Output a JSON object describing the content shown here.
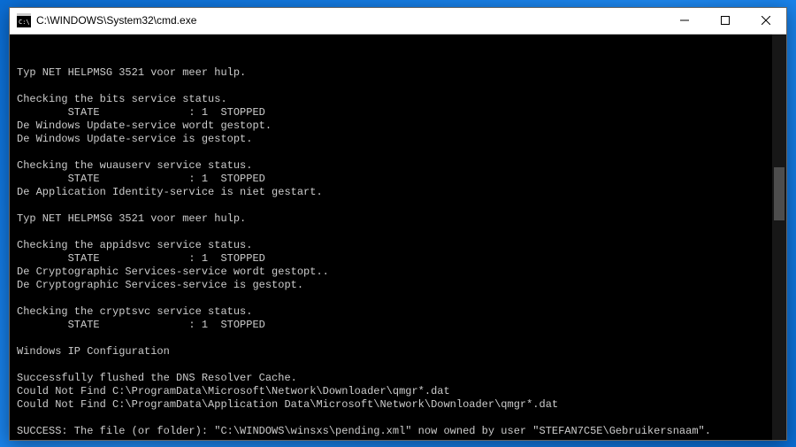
{
  "window": {
    "title": "C:\\WINDOWS\\System32\\cmd.exe"
  },
  "console": {
    "lines": [
      "Typ NET HELPMSG 3521 voor meer hulp.",
      "",
      "Checking the bits service status.",
      "        STATE              : 1  STOPPED",
      "De Windows Update-service wordt gestopt.",
      "De Windows Update-service is gestopt.",
      "",
      "Checking the wuauserv service status.",
      "        STATE              : 1  STOPPED",
      "De Application Identity-service is niet gestart.",
      "",
      "Typ NET HELPMSG 3521 voor meer hulp.",
      "",
      "Checking the appidsvc service status.",
      "        STATE              : 1  STOPPED",
      "De Cryptographic Services-service wordt gestopt..",
      "De Cryptographic Services-service is gestopt.",
      "",
      "Checking the cryptsvc service status.",
      "        STATE              : 1  STOPPED",
      "",
      "Windows IP Configuration",
      "",
      "Successfully flushed the DNS Resolver Cache.",
      "Could Not Find C:\\ProgramData\\Microsoft\\Network\\Downloader\\qmgr*.dat",
      "Could Not Find C:\\ProgramData\\Application Data\\Microsoft\\Network\\Downloader\\qmgr*.dat",
      "",
      "SUCCESS: The file (or folder): \"C:\\WINDOWS\\winsxs\\pending.xml\" now owned by user \"STEFAN7C5E\\Gebruikersnaam\"."
    ]
  }
}
